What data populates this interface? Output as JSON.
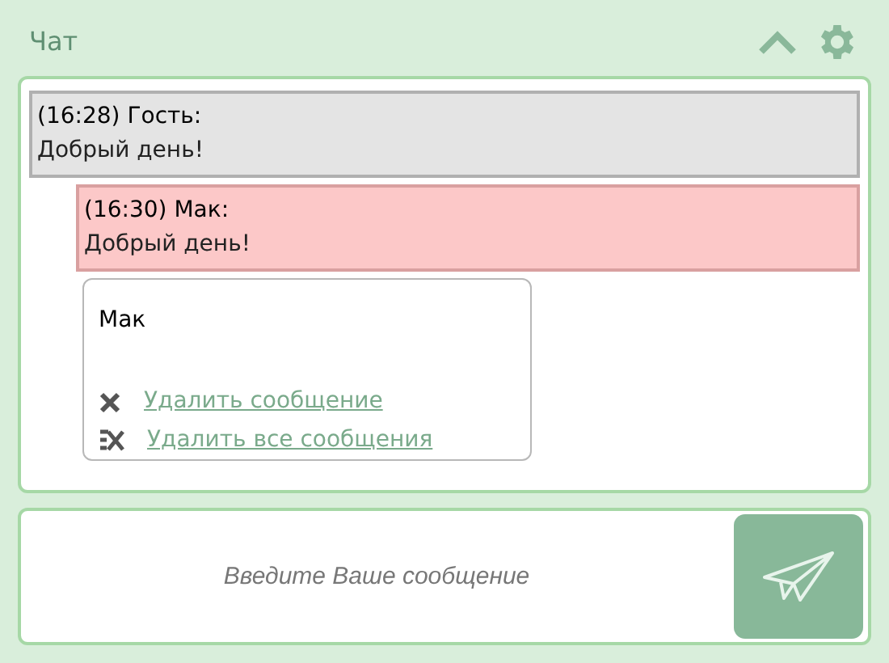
{
  "header": {
    "title": "Чат"
  },
  "messages": [
    {
      "kind": "guest",
      "meta": "(16:28) Гость:",
      "text": "Добрый день!"
    },
    {
      "kind": "own",
      "meta": "(16:30) Мак:",
      "text": "Добрый день!"
    }
  ],
  "popup": {
    "name": "Мак",
    "actions": [
      {
        "kind": "delete-one",
        "label": "Удалить сообщение"
      },
      {
        "kind": "delete-all",
        "label": "Удалить все сообщения"
      }
    ]
  },
  "composer": {
    "placeholder": "Введите Ваше сообщение"
  }
}
